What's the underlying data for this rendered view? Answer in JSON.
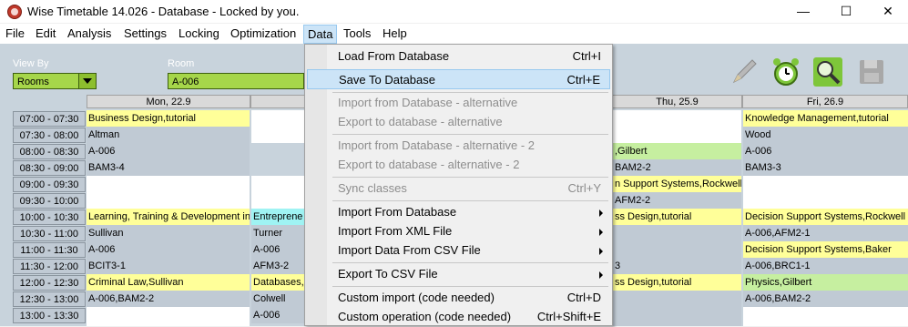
{
  "window": {
    "title": "Wise Timetable 14.026 - Database - Locked by you."
  },
  "menubar": {
    "items": [
      "File",
      "Edit",
      "Analysis",
      "Settings",
      "Locking",
      "Optimization",
      "Data",
      "Tools",
      "Help"
    ]
  },
  "toolbar": {
    "view_by_label": "View By",
    "view_by_value": "Rooms",
    "room_label": "Room",
    "room_value": "A-006"
  },
  "columns": [
    "Mon, 22.9",
    "Thu, 25.9",
    "Fri, 26.9"
  ],
  "times": [
    "07:00 - 07:30",
    "07:30 - 08:00",
    "08:00 - 08:30",
    "08:30 - 09:00",
    "09:00 - 09:30",
    "09:30 - 10:00",
    "10:00 - 10:30",
    "10:30 - 11:00",
    "11:00 - 11:30",
    "11:30 - 12:00",
    "12:00 - 12:30",
    "12:30 - 13:00",
    "13:00 - 13:30"
  ],
  "mon": {
    "c1": "Business Design,tutorial",
    "c2": "Altman",
    "c3": "A-006",
    "c4": "BAM3-4",
    "c5": "Learning, Training & Development in",
    "c6": "Sullivan",
    "c7": "A-006",
    "c8": "BCIT3-1",
    "c9": "Criminal Law,Sullivan",
    "c10": "A-006,BAM2-2"
  },
  "tue": {
    "c1": "Entreprene",
    "c2": "Turner",
    "c3": "A-006",
    "c4": "AFM3-2",
    "c5": "Databases,",
    "c6": "Colwell",
    "c7": "A-006"
  },
  "thu": {
    "c1": ",Gilbert",
    "c2": "BAM2-2",
    "c3": "n Support Systems,Rockwell",
    "c4": "AFM2-2",
    "c5": "ss Design,tutorial",
    "c6": "3",
    "c7": "ss Design,tutorial"
  },
  "fri": {
    "c1": "Knowledge Management,tutorial",
    "c2": "Wood",
    "c3": "A-006",
    "c4": "BAM3-3",
    "c5": "Decision Support Systems,Rockwell",
    "c6": "A-006,AFM2-1",
    "c7": "Decision Support Systems,Baker",
    "c8": "A-006,BRC1-1",
    "c9": "Physics,Gilbert",
    "c10": "A-006,BAM2-2"
  },
  "data_menu": {
    "items": [
      {
        "label": "Load From Database",
        "shortcut": "Ctrl+I"
      },
      {
        "label": "Save To Database",
        "shortcut": "Ctrl+E"
      },
      {
        "label": "Import from Database - alternative",
        "shortcut": ""
      },
      {
        "label": "Export to database - alternative",
        "shortcut": ""
      },
      {
        "label": "Import from Database - alternative - 2",
        "shortcut": ""
      },
      {
        "label": "Export to database - alternative - 2",
        "shortcut": ""
      },
      {
        "label": "Sync classes",
        "shortcut": "Ctrl+Y"
      },
      {
        "label": "Import From Database",
        "shortcut": ""
      },
      {
        "label": "Import From XML File",
        "shortcut": ""
      },
      {
        "label": "Import Data From CSV File",
        "shortcut": ""
      },
      {
        "label": "Export To CSV File",
        "shortcut": ""
      },
      {
        "label": "Custom import (code needed)",
        "shortcut": "Ctrl+D"
      },
      {
        "label": "Custom operation (code needed)",
        "shortcut": "Ctrl+Shift+E"
      }
    ]
  },
  "icons": {
    "app": "app-icon",
    "edit": "pencil-icon",
    "clock": "alarm-clock-icon",
    "search": "magnifier-icon",
    "save": "floppy-icon"
  }
}
